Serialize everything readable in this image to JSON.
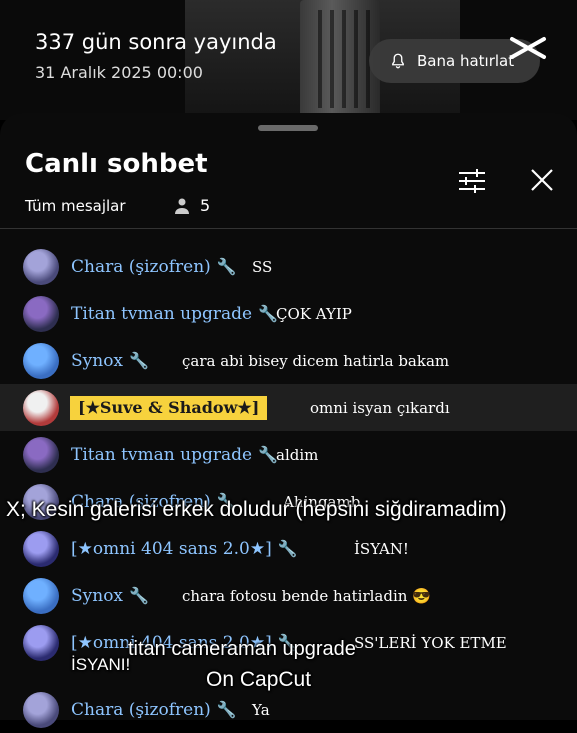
{
  "stream": {
    "title": "337 gün sonra yayında",
    "date": "31 Aralık 2025 00:00",
    "remind_label": "Bana hatırlat"
  },
  "chat": {
    "title": "Canlı sohbet",
    "tab": "Tüm mesajlar",
    "viewers": "5"
  },
  "messages": [
    {
      "author": "Chara (şizofren)",
      "text": "SS",
      "author_color": "#8ec5ff"
    },
    {
      "author": "Titan tvman upgrade",
      "text": "ÇOK AYIP",
      "author_color": "#8ec5ff"
    },
    {
      "author": "Synox",
      "text": "çara abi bisey dicem hatirla bakam",
      "author_color": "#8ec5ff"
    },
    {
      "author": "[★Suve & Shadow★]",
      "text": "omni isyan çıkardı",
      "badge": true
    },
    {
      "author": "Titan tvman upgrade",
      "text": "aldim",
      "author_color": "#8ec5ff"
    },
    {
      "author": "Chara (şizofren)",
      "text": "Ahingamb",
      "author_color": "#8ec5ff"
    },
    {
      "author": "[★omni 404 sans 2.0★]",
      "text": "İSYAN!",
      "author_color": "#8ec5ff"
    },
    {
      "author": "Synox",
      "text": "chara fotosu bende hatirladin 😎",
      "author_color": "#8ec5ff"
    },
    {
      "author": "[★omni 404 sans 2.0★]",
      "text": "SS'LERİ YOK ETME",
      "author_color": "#8ec5ff"
    },
    {
      "author": "Chara (şizofren)",
      "text": "Ya",
      "author_color": "#8ec5ff"
    }
  ],
  "overlay": {
    "caption": "X; Kesin galerisi erkek doludur (hepsini siğdiramadim)",
    "isyan": "İSYANI!",
    "titan": "titan cameraman upgrade",
    "capcut": "On CapCut"
  },
  "colors": {
    "accent_name": "#8ec5ff",
    "badge_bg": "#f7d23d",
    "highlight_row": "#1f1f1f"
  },
  "icons": [
    "bell-icon",
    "filter-icon",
    "close-icon",
    "person-icon",
    "wrench-icon",
    "capcut-logo"
  ]
}
